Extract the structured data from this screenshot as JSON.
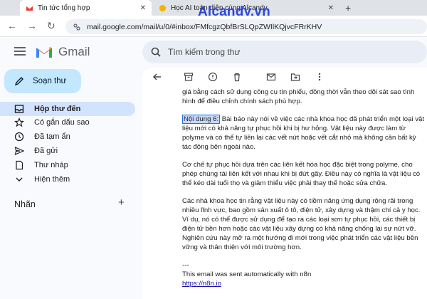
{
  "browser": {
    "tabs": [
      {
        "title": "Tin tức tổng hợp",
        "active": true
      },
      {
        "title": "Học AI toàn diện cùng Alcandy",
        "active": false
      }
    ],
    "watermark": "Alcandy.vn",
    "url": "mail.google.com/mail/u/0/#inbox/FMfcgzQbfBrSLQpZWIlKQjvcFRrKHV"
  },
  "gmail": {
    "brand": "Gmail",
    "search_placeholder": "Tìm kiếm trong thư",
    "compose_label": "Soạn thư",
    "nav": [
      {
        "label": "Hộp thư đến",
        "icon": "inbox-icon",
        "active": true
      },
      {
        "label": "Có gắn dấu sao",
        "icon": "star-icon",
        "active": false
      },
      {
        "label": "Đã tạm ẩn",
        "icon": "clock-icon",
        "active": false
      },
      {
        "label": "Đã gửi",
        "icon": "send-icon",
        "active": false
      },
      {
        "label": "Thư nháp",
        "icon": "draft-icon",
        "active": false
      },
      {
        "label": "Hiện thêm",
        "icon": "chevron-down-icon",
        "active": false
      }
    ],
    "labels_heading": "Nhãn"
  },
  "email": {
    "intro": "giá bằng cách sử dụng công cụ tín phiếu, đồng thời vẫn theo dõi sát sao tình hình để điều chỉnh chính sách phù hợp.",
    "highlight": "Nội dung 6:",
    "p1_rest": " Bài báo này nói về việc các nhà khoa học đã phát triển một loại vật liệu mới có khả năng tự phục hồi khi bị hư hỏng. Vật liệu này được làm từ polyme và có thể tự liền lại các vết nứt hoặc vết cắt nhỏ mà không cần bất kỳ tác động bên ngoài nào.",
    "p2": "Cơ chế tự phục hồi dựa trên các liên kết hóa học đặc biệt trong polyme, cho phép chúng tái liên kết với nhau khi bị đứt gãy. Điều này có nghĩa là vật liệu có thể kéo dài tuổi thọ và giảm thiểu việc phải thay thế hoặc sửa chữa.",
    "p3": "Các nhà khoa học tin rằng vật liệu này có tiềm năng ứng dụng rộng rãi trong nhiều lĩnh vực, bao gồm sản xuất ô tô, điện tử, xây dựng và thậm chí cả y học. Ví dụ, nó có thể được sử dụng để tạo ra các loại sơn tự phục hồi, các thiết bị điện tử bền hơn hoặc các vật liệu xây dựng có khả năng chống lại sự nứt vỡ. Nghiên cứu này mở ra một hướng đi mới trong việc phát triển các vật liệu bền vững và thân thiện với môi trường hơn.",
    "separator": "---",
    "footer": "This email was sent automatically with n8n",
    "link": "https://n8n.io"
  },
  "colors": {
    "accent": "#1a73e8",
    "compose": "#c2e7ff",
    "active_nav": "#d3e3fd"
  }
}
